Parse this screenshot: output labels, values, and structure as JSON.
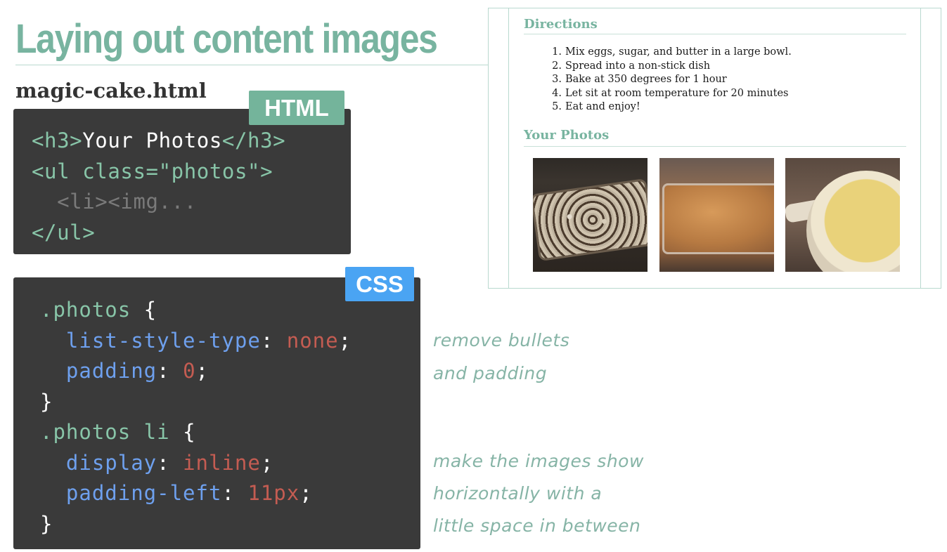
{
  "slide": {
    "title": "Laying out content images",
    "filename": "magic-cake.html",
    "accent_color": "#78b4a0"
  },
  "html_panel": {
    "badge": "HTML",
    "badge_color": "#74b49b",
    "lines": {
      "l1_open": "<h3>",
      "l1_text": "Your Photos",
      "l1_close": "</h3>",
      "l2": "<ul class=\"photos\">",
      "l3": "  <li><img...",
      "l4": "</ul>"
    }
  },
  "css_panel": {
    "badge": "CSS",
    "badge_color": "#4aa4f3",
    "rule1": {
      "selector": ".photos",
      "open": " {",
      "prop1": "list-style-type",
      "val1": "none",
      "prop2": "padding",
      "val2": "0",
      "close": "}"
    },
    "rule2": {
      "selector": ".photos li",
      "open": " {",
      "prop1": "display",
      "val1": "inline",
      "prop2": "padding-left",
      "val2": "11px",
      "close": "}"
    }
  },
  "notes": {
    "note1_line1": "remove bullets",
    "note1_line2": "and padding",
    "note2_line1": "make the images show",
    "note2_line2": "horizontally with a",
    "note2_line3": "little space in between"
  },
  "preview": {
    "directions_heading": "Directions",
    "steps": [
      {
        "num": "1.",
        "text": "Mix eggs, sugar, and butter in a large bowl."
      },
      {
        "num": "2.",
        "text": "Spread into a non-stick dish"
      },
      {
        "num": "3.",
        "text": "Bake at 350 degrees for 1 hour"
      },
      {
        "num": "4.",
        "text": "Let sit at room temperature for 20 minutes"
      },
      {
        "num": "5.",
        "text": "Eat and enjoy!"
      }
    ],
    "photos_heading": "Your Photos"
  }
}
